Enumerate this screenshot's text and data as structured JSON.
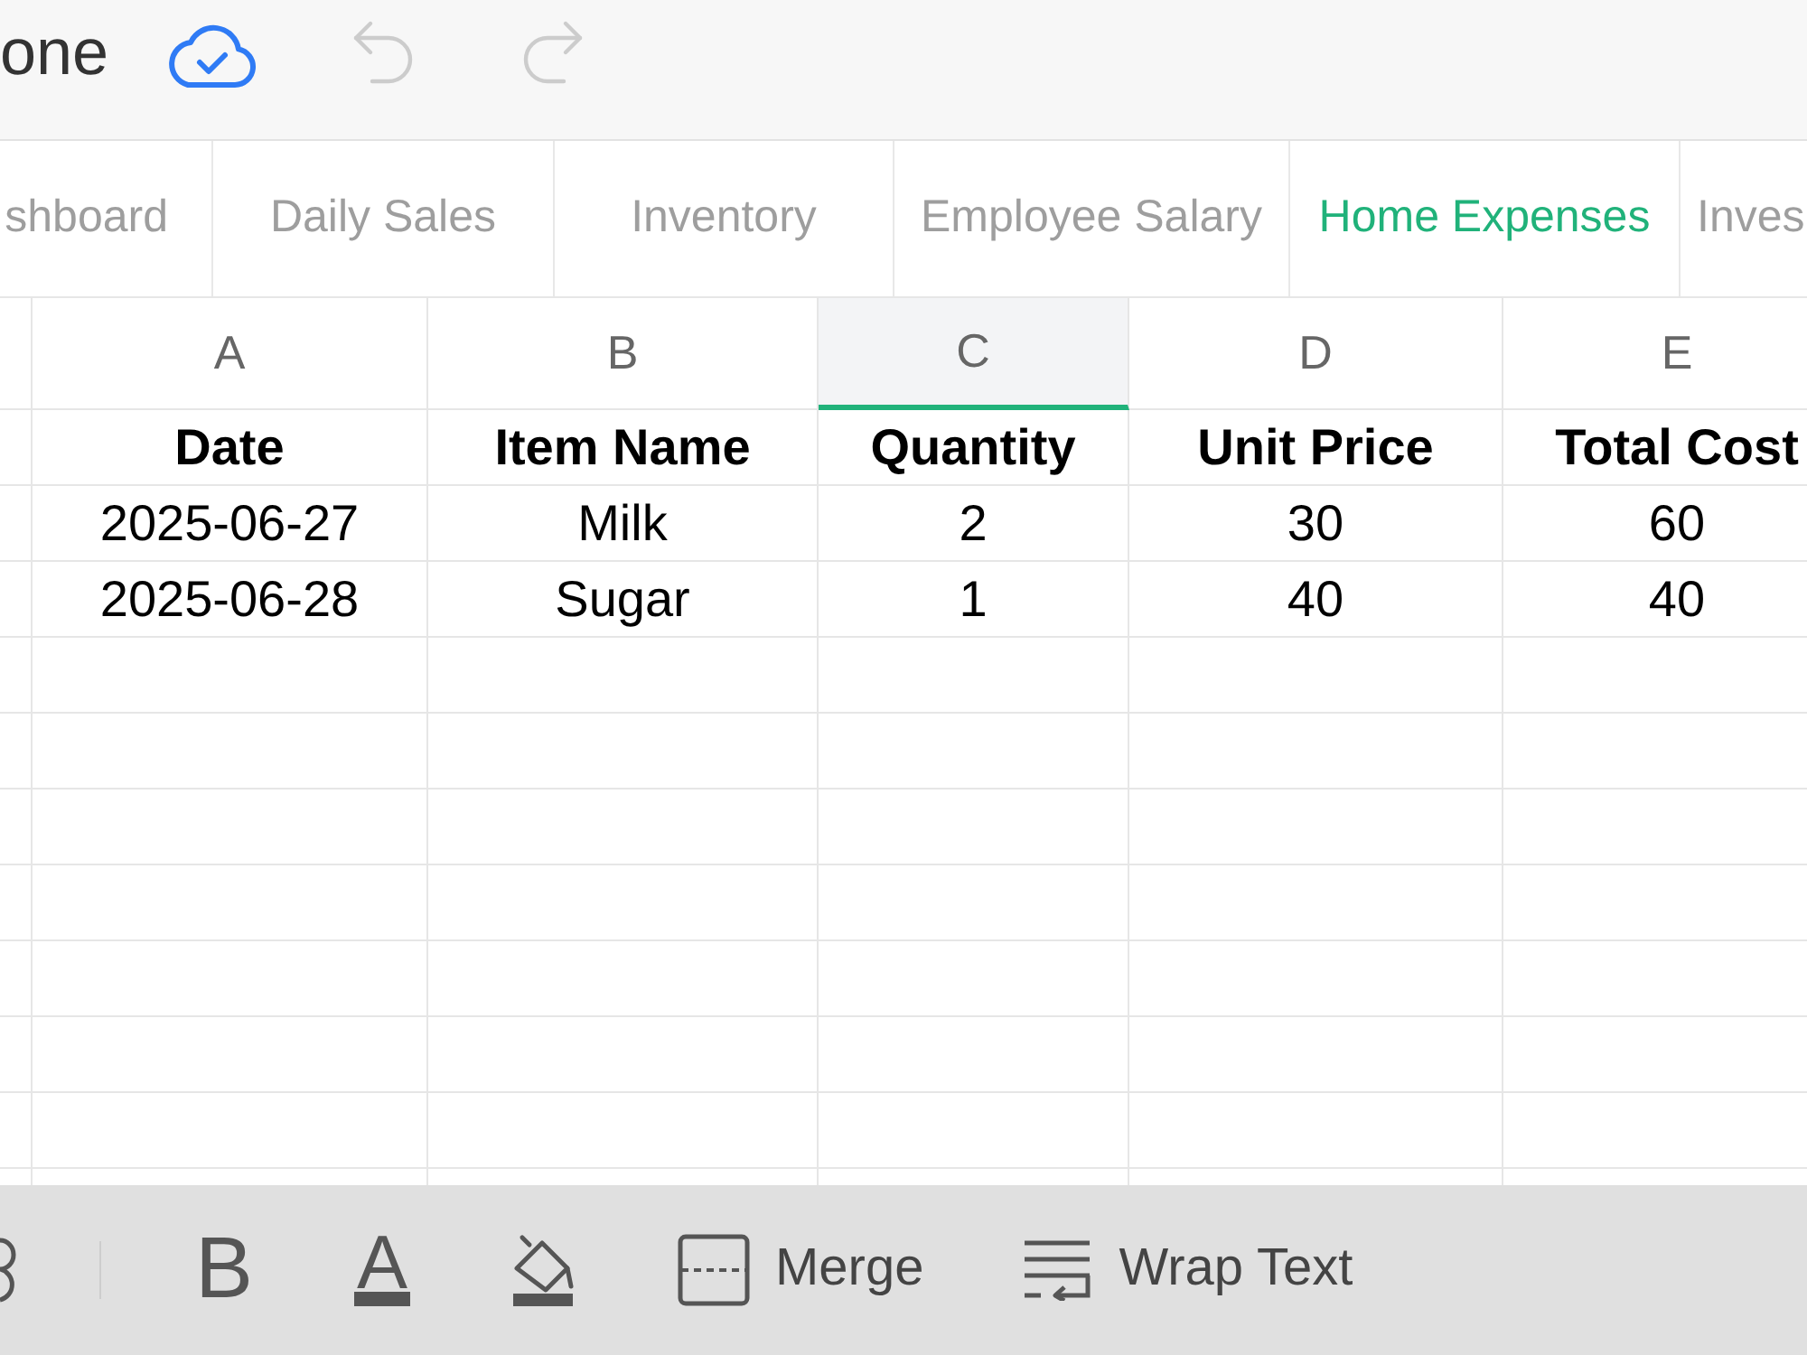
{
  "top_bar": {
    "title": "one",
    "actions": [
      {
        "kind": "sync"
      },
      {
        "kind": "undo",
        "disabled": true
      },
      {
        "kind": "redo",
        "disabled": true
      }
    ]
  },
  "tabs": [
    {
      "label": "shboard",
      "selected": false
    },
    {
      "label": "Daily Sales",
      "selected": false
    },
    {
      "label": "Inventory",
      "selected": false
    },
    {
      "label": "Employee Salary",
      "selected": false
    },
    {
      "label": "Home Expenses",
      "selected": true
    },
    {
      "label": "Inves",
      "selected": false
    }
  ],
  "sheet": {
    "columns": [
      {
        "letter": "A",
        "selected": false
      },
      {
        "letter": "B",
        "selected": false
      },
      {
        "letter": "C",
        "selected": true
      },
      {
        "letter": "D",
        "selected": false
      },
      {
        "letter": "E",
        "selected": false
      }
    ],
    "header": [
      "Date",
      "Item Name",
      "Quantity",
      "Unit Price",
      "Total Cost"
    ],
    "rows": [
      [
        "2025-06-27",
        "Milk",
        "2",
        "30",
        "60"
      ],
      [
        "2025-06-28",
        "Sugar",
        "1",
        "40",
        "40"
      ]
    ]
  },
  "toolbar": {
    "items": [
      {
        "kind": "partial"
      },
      {
        "kind": "bold",
        "text": "B"
      },
      {
        "kind": "text_color",
        "text": "A"
      },
      {
        "kind": "fill_color"
      },
      {
        "kind": "merge",
        "label": "Merge"
      },
      {
        "kind": "wrap",
        "label": "Wrap Text"
      }
    ]
  }
}
